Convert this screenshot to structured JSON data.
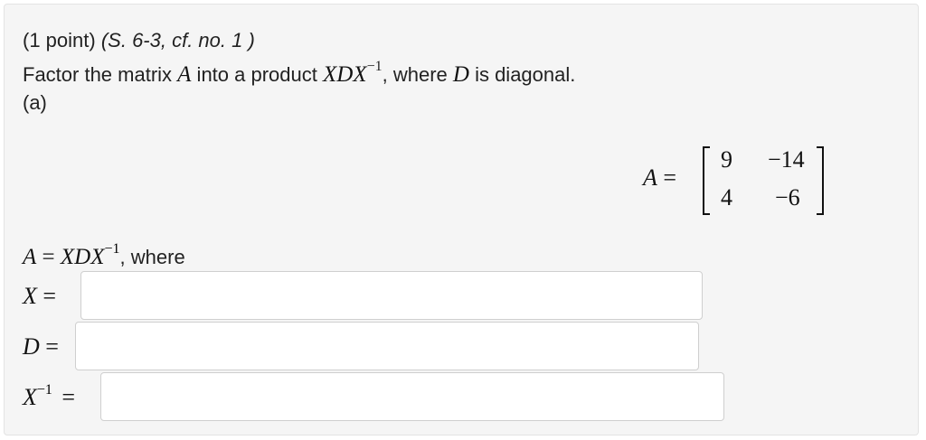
{
  "header": {
    "points": "(1 point)",
    "source": "(S. 6-3, cf. no. 1 )",
    "instruction_prefix": "Factor the matrix ",
    "instruction_var": "A",
    "instruction_mid": " into a product ",
    "instruction_product": "XDX",
    "instruction_exp": "−1",
    "instruction_where": ", where ",
    "instruction_d": "D",
    "instruction_suffix": " is diagonal.",
    "part": "(a)"
  },
  "matrix": {
    "label": "A",
    "equals": " =",
    "rows": [
      [
        "9",
        "−14"
      ],
      [
        "4",
        "−6"
      ]
    ]
  },
  "equation": {
    "lhs": "A",
    "eq": " = ",
    "product": "XDX",
    "exp": "−1",
    "where": ", where"
  },
  "answers": [
    {
      "label": "X",
      "exp": "",
      "equals": " =",
      "value": ""
    },
    {
      "label": "D",
      "exp": "",
      "equals": " =",
      "value": ""
    },
    {
      "label": "X",
      "exp": "−1",
      "equals": " =",
      "value": ""
    }
  ]
}
